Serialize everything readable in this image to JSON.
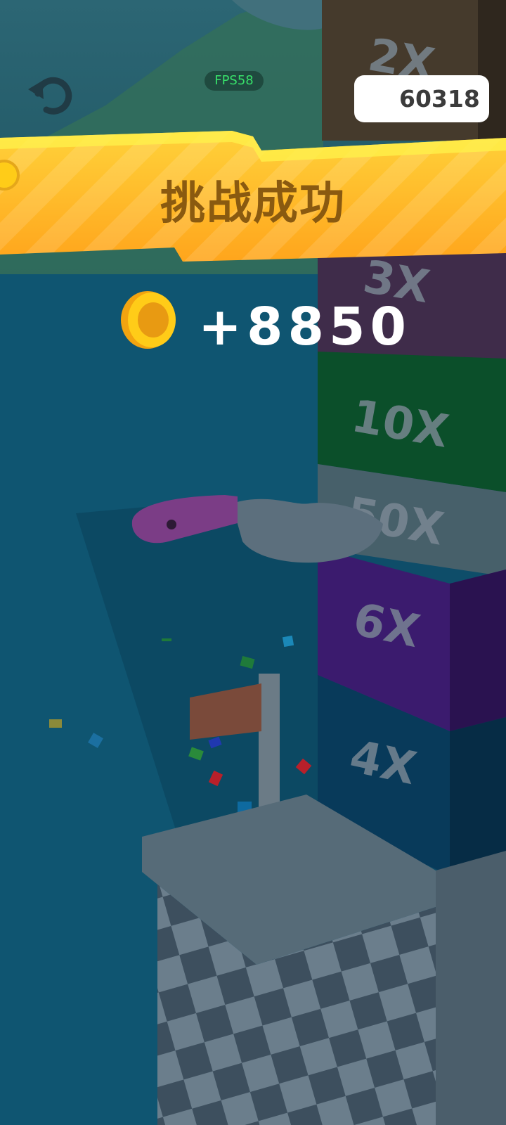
{
  "hud": {
    "fps_label": "FPS58",
    "coin_total": "60318",
    "restart_icon": "restart-icon",
    "coin_icon": "coin-icon"
  },
  "result": {
    "title": "挑战成功",
    "reward_text": "+8850"
  },
  "tower": {
    "blocks": [
      {
        "label": "2X",
        "color": "#453a2c"
      },
      {
        "label": "3X",
        "color": "#3f2c4a"
      },
      {
        "label": "10X",
        "color": "#0b4f2a"
      },
      {
        "label": "50X",
        "color": "#47606a"
      },
      {
        "label": "6X",
        "color": "#3b1b6e"
      },
      {
        "label": "4X",
        "color": "#083a5a"
      }
    ]
  },
  "colors": {
    "banner": "#ffb21c",
    "banner_text": "#8a5a10",
    "water": "#0f4f6a",
    "coin": "#ffcc18",
    "fps_text": "#38e06a"
  }
}
